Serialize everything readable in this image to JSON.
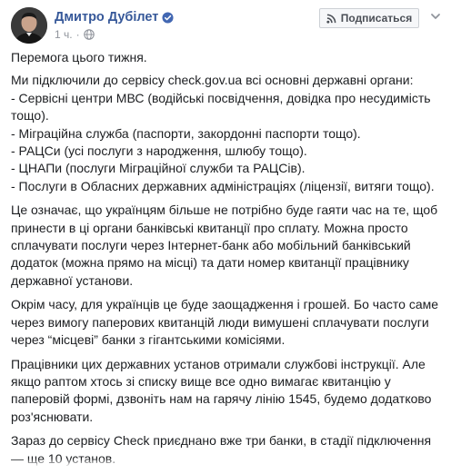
{
  "post": {
    "author": "Дмитро Дубілет",
    "time": "1 ч.",
    "dot": "·",
    "subscribe_label": "Подписаться",
    "paragraphs": [
      [
        "Перемога цього тижня."
      ],
      [
        "Ми підключили до сервісу check.gov.ua всі основні державні органи:",
        "- Сервісні центри МВС (водійські посвідчення, довідка про несудимість",
        "тощо).",
        "- Міграційна служба (паспорти, закордонні паспорти тощо).",
        "- РАЦСи (усі послуги з народження, шлюбу тощо).",
        "- ЦНАПи (послуги Міграційної служби та РАЦСів).",
        "- Послуги в Обласних державних адміністраціях (ліцензії, витяги тощо)."
      ],
      [
        "Це означає, що українцям більше не потрібно буде гаяти час на те, щоб",
        "принести в ці органи банківські квитанції про сплату. Можна просто",
        "сплачувати послуги через Інтернет-банк або мобільний банківський",
        "додаток (можна прямо на місці) та дати номер квитанції працівнику",
        "державної установи."
      ],
      [
        "Окрім часу, для українців це буде заощадження і грошей. Бо часто саме",
        "через вимогу паперових квитанцій люди вимушені сплачувати послуги",
        "через “місцеві” банки з гігантськими комісіями."
      ],
      [
        "Працівники цих державних установ отримали службові інструкції. Але",
        "якщо раптом хтось зі списку вище все одно вимагає квитанцію у",
        "паперовій формі, дзвоніть нам на гарячу лінію 1545, будемо додатково",
        "роз'яснювати."
      ],
      [
        "Зараз до сервісу Check приєднано вже три банки, в стадії підключення",
        "— ще 10 установ."
      ]
    ]
  },
  "icons": {
    "verified": "verified-badge-icon",
    "globe": "globe-icon",
    "rss": "rss-icon",
    "chevron": "chevron-down-icon"
  },
  "colors": {
    "author_link": "#365899",
    "verified": "#4267b2",
    "meta": "#90949c",
    "text": "#1c1e21",
    "button_bg": "#f6f7f9",
    "button_border": "#ccd0d5"
  }
}
